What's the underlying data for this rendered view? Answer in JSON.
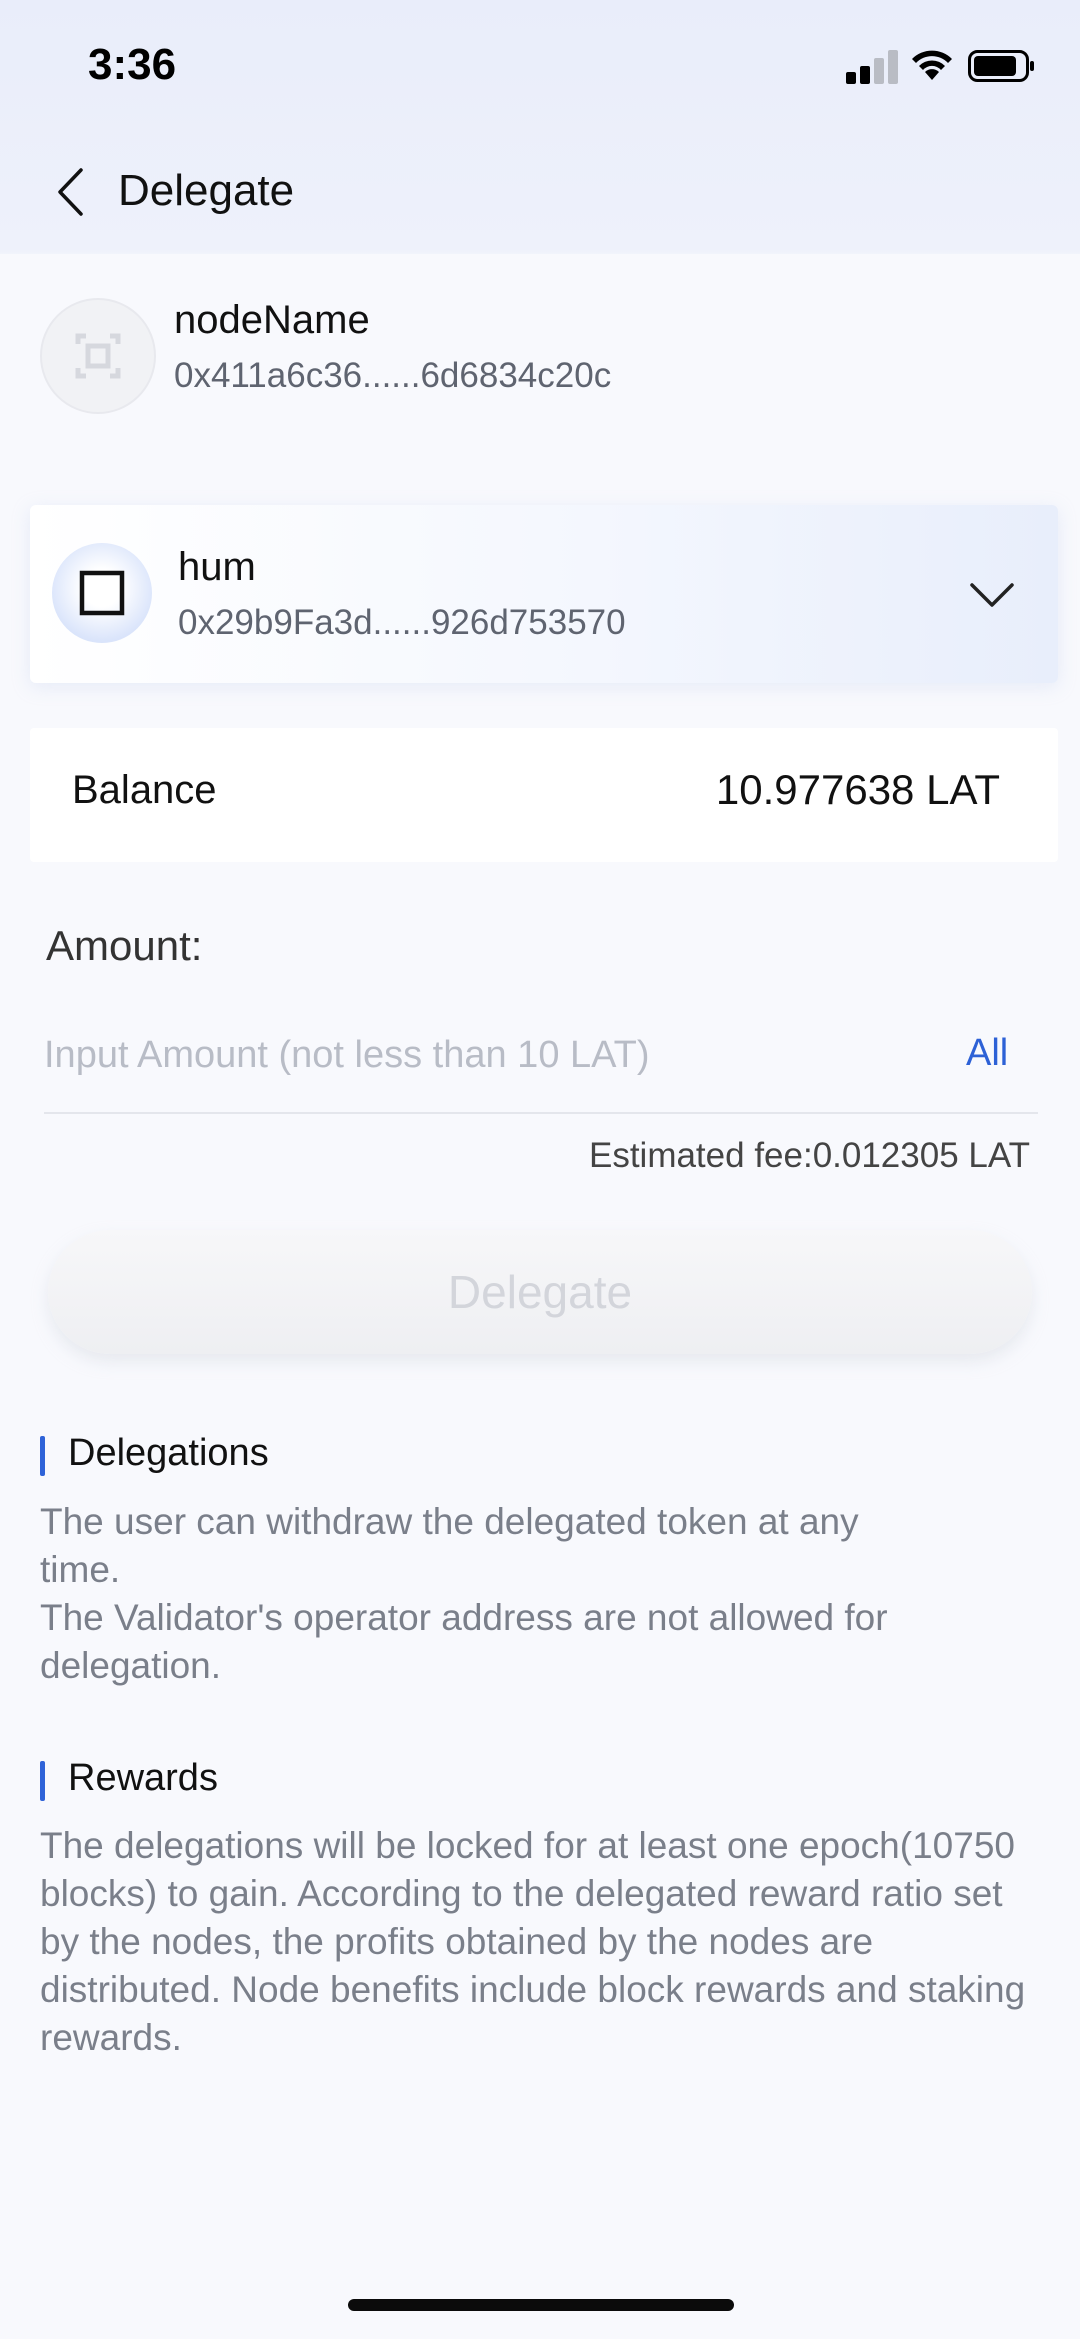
{
  "status_bar": {
    "time": "3:36"
  },
  "header": {
    "title": "Delegate"
  },
  "node": {
    "name": "nodeName",
    "address": "0x411a6c36......6d6834c20c"
  },
  "wallet": {
    "name": "hum",
    "address": "0x29b9Fa3d......926d753570"
  },
  "balance": {
    "label": "Balance",
    "value": "10.977638 LAT"
  },
  "amount": {
    "label": "Amount:",
    "placeholder": "Input Amount (not less than 10 LAT)",
    "value": "",
    "all_label": "All",
    "fee": "Estimated fee:0.012305 LAT"
  },
  "delegate_button": {
    "label": "Delegate"
  },
  "sections": [
    {
      "title": "Delegations",
      "paragraphs": [
        "The user can withdraw the delegated token at any time.",
        "The Validator's operator address are not allowed for delegation."
      ]
    },
    {
      "title": "Rewards",
      "paragraphs": [
        "The delegations will be locked for at least one epoch(10750 blocks) to gain. According to the delegated reward ratio set by the nodes, the profits obtained by the nodes are distributed. Node benefits include block rewards and staking rewards."
      ]
    }
  ],
  "colors": {
    "accent": "#2d61d6",
    "section_bar": "#2f63d8",
    "button_disabled_text": "#d3d5db"
  },
  "icons": {
    "back": "chevron-left-icon",
    "node_avatar": "node-square-icon",
    "wallet_avatar": "square-outline-icon",
    "dropdown": "chevron-down-icon"
  }
}
